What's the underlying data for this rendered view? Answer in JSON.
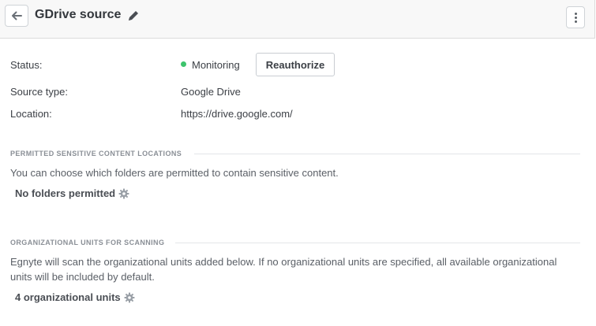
{
  "header": {
    "title": "GDrive source",
    "back_icon": "arrow-left-icon",
    "edit_icon": "pencil-icon",
    "more_icon": "kebab-menu-icon"
  },
  "details": {
    "status_label": "Status:",
    "status_value": "Monitoring",
    "status_color": "#3ec46d",
    "reauthorize_label": "Reauthorize",
    "source_type_label": "Source type:",
    "source_type_value": "Google Drive",
    "location_label": "Location:",
    "location_value": "https://drive.google.com/"
  },
  "permitted_locations": {
    "heading": "PERMITTED SENSITIVE CONTENT LOCATIONS",
    "description": "You can choose which folders are permitted to contain sensitive content.",
    "setting_label": "No folders permitted",
    "setting_icon": "gear-icon"
  },
  "org_units": {
    "heading": "ORGANIZATIONAL UNITS FOR SCANNING",
    "description": "Egnyte will scan the organizational units added below. If no organizational units are specified, all available organizational units will be included by default.",
    "setting_label": "4 organizational units",
    "setting_icon": "gear-icon"
  }
}
